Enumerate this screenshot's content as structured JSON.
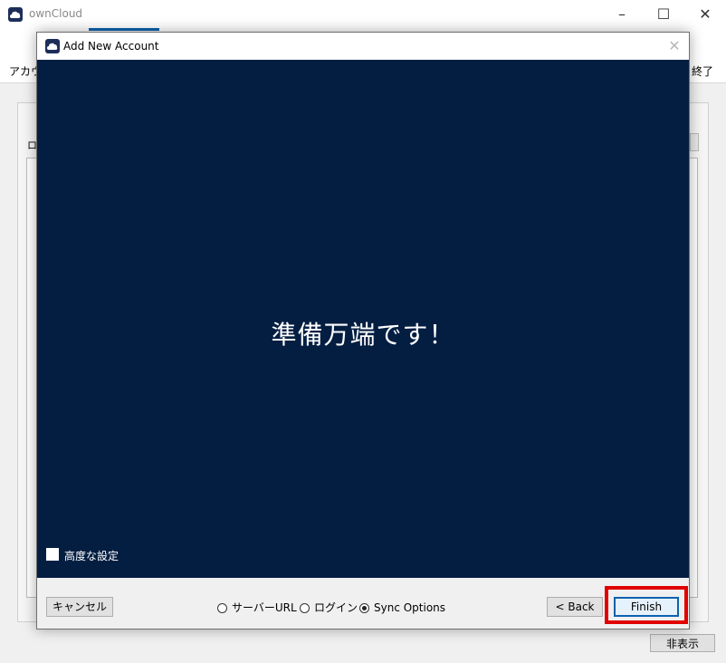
{
  "main_window": {
    "title": "ownCloud",
    "minimize_icon": "minimize-icon",
    "maximize_icon": "maximize-icon",
    "close_icon": "close-icon",
    "toolbar_left_label": "アカウ",
    "toolbar_right_label": "終了",
    "panel_left_char": "ロ",
    "hide_button": "非表示"
  },
  "dialog": {
    "title": "Add New Account",
    "close_icon": "close-icon",
    "headline": "準備万端です！",
    "advanced_settings_label": "高度な設定",
    "advanced_settings_checked": false,
    "cancel_button": "キャンセル",
    "back_button": "< Back",
    "finish_button": "Finish",
    "steps": [
      {
        "label": "サーバーURL",
        "selected": false
      },
      {
        "label": "ログイン",
        "selected": false
      },
      {
        "label": "Sync Options",
        "selected": true
      }
    ]
  },
  "colors": {
    "content_background": "#041e42",
    "accent": "#0a62b0",
    "highlight": "#e00000"
  }
}
